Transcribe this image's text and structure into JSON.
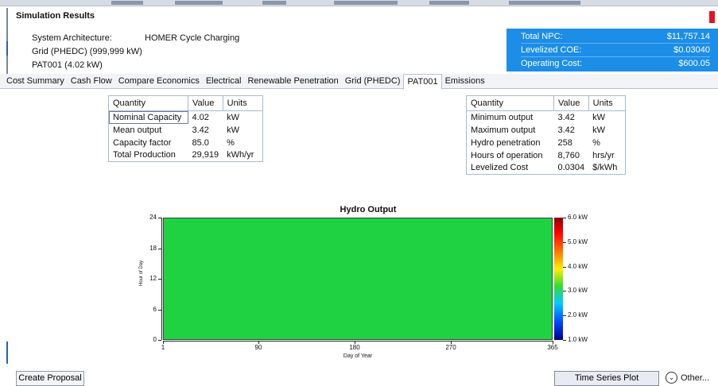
{
  "window": {
    "title": "Simulation Results"
  },
  "architecture": {
    "label": "System Architecture:",
    "value": "HOMER Cycle Charging",
    "line2": "Grid (PHEDC) (999,999 kW)",
    "line3": "PAT001 (4.02 kW)"
  },
  "summary": [
    {
      "label": "Total NPC:",
      "value": "$11,757.14"
    },
    {
      "label": "Levelized COE:",
      "value": "$0.03040"
    },
    {
      "label": "Operating Cost:",
      "value": "$600.05"
    }
  ],
  "tabs": [
    {
      "label": "Cost Summary"
    },
    {
      "label": "Cash Flow"
    },
    {
      "label": "Compare Economics"
    },
    {
      "label": "Electrical"
    },
    {
      "label": "Renewable Penetration"
    },
    {
      "label": "Grid (PHEDC)"
    },
    {
      "label": "PAT001",
      "active": true
    },
    {
      "label": "Emissions"
    }
  ],
  "table_left": {
    "headers": [
      "Quantity",
      "Value",
      "Units"
    ],
    "rows": [
      [
        "Nominal Capacity",
        "4.02",
        "kW"
      ],
      [
        "Mean output",
        "3.42",
        "kW"
      ],
      [
        "Capacity factor",
        "85.0",
        "%"
      ],
      [
        "Total Production",
        "29,919",
        "kWh/yr"
      ]
    ]
  },
  "table_right": {
    "headers": [
      "Quantity",
      "Value",
      "Units"
    ],
    "rows": [
      [
        "Minimum output",
        "3.42",
        "kW"
      ],
      [
        "Maximum output",
        "3.42",
        "kW"
      ],
      [
        "Hydro penetration",
        "258",
        "%"
      ],
      [
        "Hours of operation",
        "8,760",
        "hrs/yr"
      ],
      [
        "Levelized Cost",
        "0.0304",
        "$/kWh"
      ]
    ]
  },
  "chart_data": {
    "type": "heatmap",
    "title": "Hydro Output",
    "xlabel": "Day of Year",
    "ylabel": "Hour of Day",
    "x_ticks": [
      "1",
      "90",
      "180",
      "270",
      "365"
    ],
    "y_ticks": [
      "0",
      "6",
      "12",
      "18",
      "24"
    ],
    "xlim": [
      1,
      365
    ],
    "ylim": [
      0,
      24
    ],
    "value_kw": 3.42,
    "uniform": true,
    "fill_color": "#1fd242",
    "colorbar": {
      "min": 1.0,
      "max": 6.0,
      "unit": "kW",
      "labels": [
        "6.0 kW",
        "5.0 kW",
        "4.0 kW",
        "3.0 kW",
        "2.0 kW",
        "1.0 kW"
      ]
    }
  },
  "buttons": {
    "create_proposal": "Create Proposal",
    "time_series_plot": "Time Series Plot",
    "other": "Other..."
  },
  "colors": {
    "summary_bg": "#1c8ee8",
    "heatmap_fill": "#1fd242",
    "close_red": "#e81123"
  }
}
